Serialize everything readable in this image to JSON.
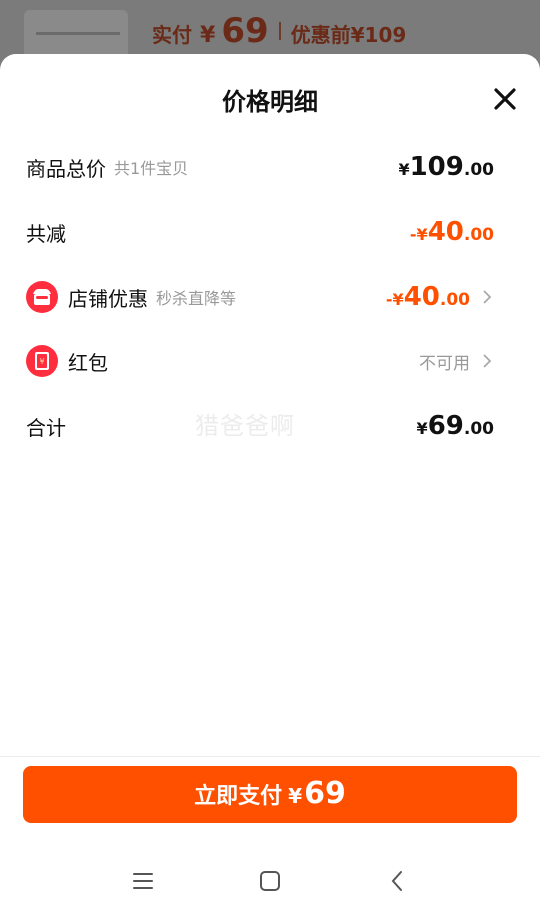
{
  "background": {
    "paid_label": "实付",
    "paid_symbol": "¥",
    "paid_amount": "69",
    "original_label": "优惠前",
    "original_price": "¥109"
  },
  "sheet": {
    "title": "价格明细",
    "rows": {
      "total": {
        "label": "商品总价",
        "sub": "共1件宝贝",
        "symbol": "¥",
        "int": "109",
        "dec": ".00"
      },
      "reduce": {
        "label": "共减",
        "symbol": "-¥",
        "int": "40",
        "dec": ".00"
      },
      "shop": {
        "label": "店铺优惠",
        "sub": "秒杀直降等",
        "symbol": "-¥",
        "int": "40",
        "dec": ".00"
      },
      "redpacket": {
        "label": "红包",
        "value": "不可用"
      },
      "sum": {
        "label": "合计",
        "symbol": "¥",
        "int": "69",
        "dec": ".00"
      }
    },
    "watermark": "猎爸爸啊",
    "pay_button": {
      "label": "立即支付",
      "symbol": "¥",
      "amount": "69"
    }
  },
  "colors": {
    "accent": "#ff5000",
    "icon_red": "#ff2d3d",
    "muted": "#999999"
  },
  "icons": [
    "close-icon",
    "store-icon",
    "red-packet-icon",
    "chevron-right-icon",
    "menu-icon",
    "home-icon",
    "back-icon"
  ]
}
